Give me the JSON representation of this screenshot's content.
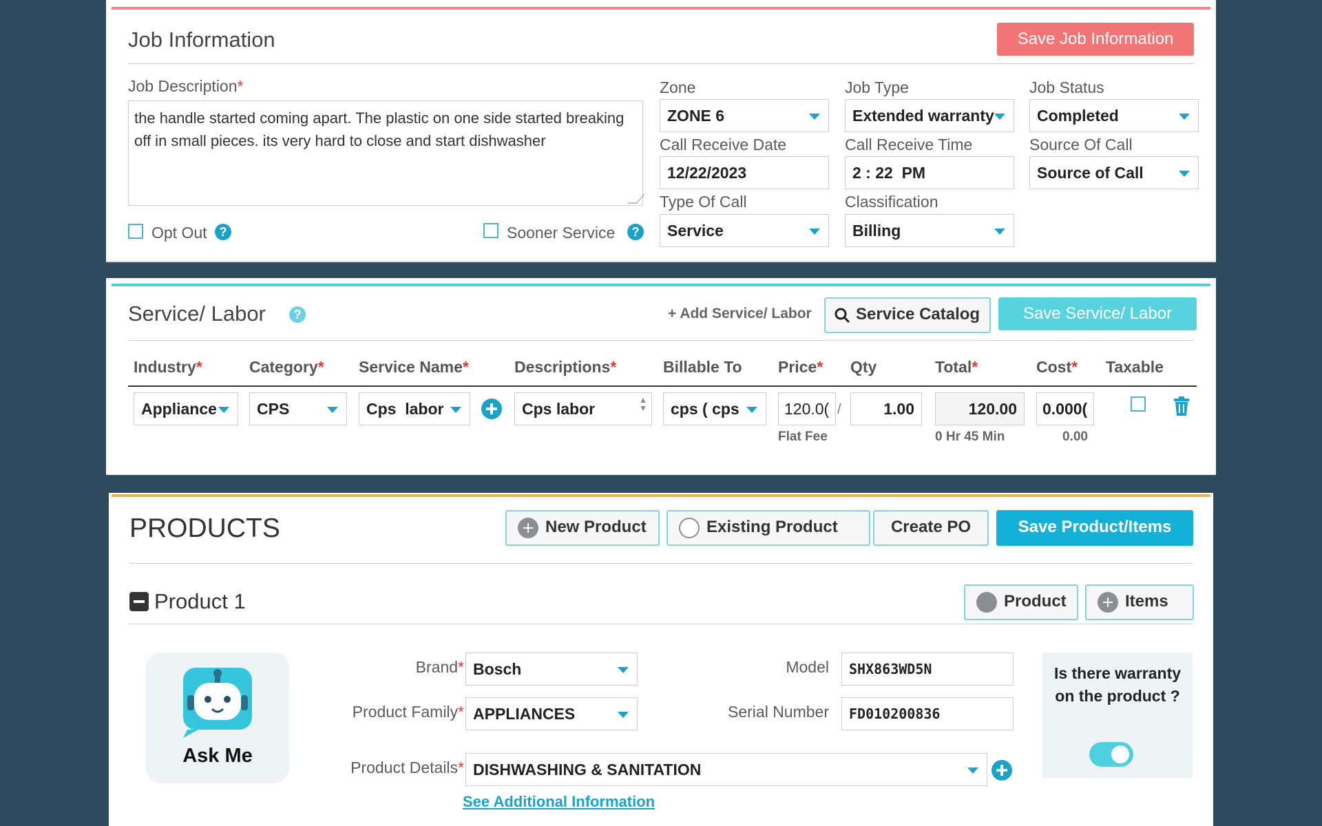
{
  "job_info": {
    "title": "Job Information",
    "save_button": "Save Job Information",
    "description_label": "Job Description",
    "description_required": "*",
    "description_value": "the handle started coming apart. The plastic on one side started breaking off in small pieces. its very hard to close and start dishwasher",
    "opt_out_label": "Opt Out",
    "sooner_service_label": "Sooner Service",
    "zone_label": "Zone",
    "zone_value": "ZONE 6",
    "job_type_label": "Job Type",
    "job_type_value": "Extended warranty",
    "job_status_label": "Job Status",
    "job_status_value": "Completed",
    "call_receive_date_label": "Call Receive Date",
    "call_receive_date_value": "12/22/2023",
    "call_receive_time_label": "Call Receive Time",
    "call_receive_time_value": "2 : 22  PM",
    "source_of_call_label": "Source Of Call",
    "source_of_call_value": "Source of Call",
    "type_of_call_label": "Type Of Call",
    "type_of_call_value": "Service",
    "classification_label": "Classification",
    "classification_value": "Billing"
  },
  "service_labor": {
    "title": "Service/ Labor",
    "add_link": "+ Add Service/ Labor",
    "catalog_button": "Service Catalog",
    "save_button": "Save Service/ Labor",
    "columns": {
      "industry": "Industry",
      "category": "Category",
      "service_name": "Service Name",
      "descriptions": "Descriptions",
      "billable_to": "Billable To",
      "price": "Price",
      "qty": "Qty",
      "total": "Total",
      "cost": "Cost",
      "taxable": "Taxable"
    },
    "row": {
      "industry": "Appliance",
      "category": "CPS",
      "service_name": "Cps  labor",
      "description": "Cps labor",
      "billable_to": "cps ( cps",
      "price": "120.0(",
      "price_suffix": "/",
      "price_note": "Flat Fee",
      "qty": "1.00",
      "total": "120.00",
      "total_note": "0 Hr 45 Min",
      "cost": "0.000(",
      "cost_note": "0.00"
    }
  },
  "products": {
    "title": "PRODUCTS",
    "new_product": "New Product",
    "existing_product": "Existing Product",
    "create_po": "Create PO",
    "save_button": "Save Product/Items",
    "product_title": "Product 1",
    "product_button": "Product",
    "items_button": "Items",
    "ask_me": "Ask Me",
    "brand_label": "Brand",
    "brand_value": "Bosch",
    "family_label": "Product Family",
    "family_value": "APPLIANCES",
    "details_label": "Product Details",
    "details_value": "DISHWASHING & SANITATION",
    "model_label": "Model",
    "model_value": "SHX863WD5N",
    "serial_label": "Serial Number",
    "serial_value": "FD010200836",
    "warranty_question": "Is there warranty on the product ?",
    "see_more": "See Additional Information"
  }
}
